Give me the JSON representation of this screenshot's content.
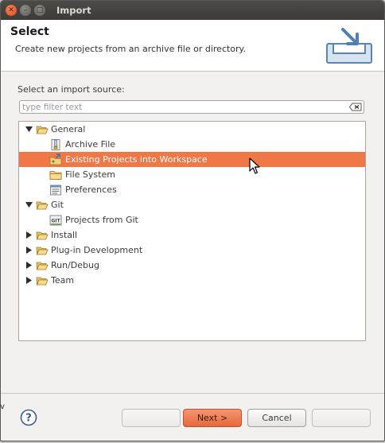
{
  "window": {
    "title": "Import"
  },
  "header": {
    "title": "Select",
    "description": "Create new projects from an archive file or directory."
  },
  "source_label": "Select an import source:",
  "filter": {
    "placeholder": "type filter text",
    "value": ""
  },
  "tree": [
    {
      "label": "General",
      "level": 0,
      "expanded": true,
      "icon": "folder-open-icon"
    },
    {
      "label": "Archive File",
      "level": 1,
      "icon": "archive-icon"
    },
    {
      "label": "Existing Projects into Workspace",
      "level": 1,
      "icon": "project-icon",
      "selected": true
    },
    {
      "label": "File System",
      "level": 1,
      "icon": "folder-icon"
    },
    {
      "label": "Preferences",
      "level": 1,
      "icon": "preferences-icon"
    },
    {
      "label": "Git",
      "level": 0,
      "expanded": true,
      "icon": "folder-open-icon"
    },
    {
      "label": "Projects from Git",
      "level": 1,
      "icon": "git-icon"
    },
    {
      "label": "Install",
      "level": 0,
      "expanded": false,
      "icon": "folder-open-icon"
    },
    {
      "label": "Plug-in Development",
      "level": 0,
      "expanded": false,
      "icon": "folder-open-icon"
    },
    {
      "label": "Run/Debug",
      "level": 0,
      "expanded": false,
      "icon": "folder-open-icon"
    },
    {
      "label": "Team",
      "level": 0,
      "expanded": false,
      "icon": "folder-open-icon"
    }
  ],
  "buttons": {
    "back": "",
    "next": "Next >",
    "cancel": "Cancel",
    "finish": ""
  },
  "edge_text": "v",
  "colors": {
    "selection": "#f07746",
    "accent": "#e6683a",
    "titlebar": "#3c3b37"
  }
}
